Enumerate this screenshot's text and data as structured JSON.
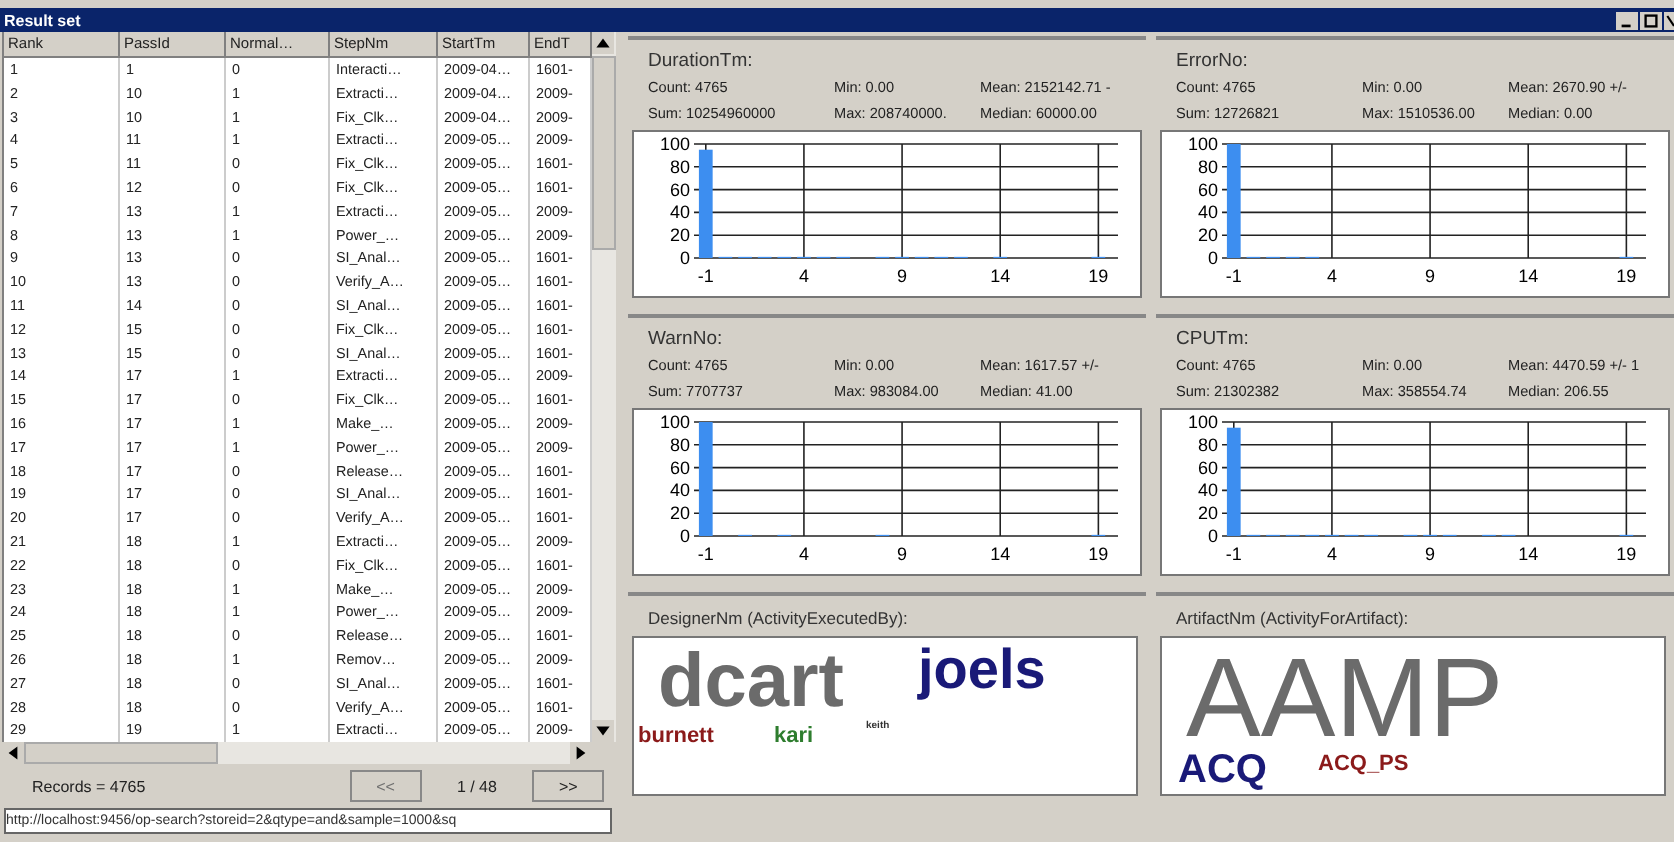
{
  "left_window": {
    "title": "Result set",
    "table": {
      "columns": [
        "Rank",
        "PassId",
        "Normal…",
        "StepNm",
        "StartTm",
        "EndT"
      ],
      "rows": [
        [
          "1",
          "1",
          "0",
          "Interacti…",
          "2009-04…",
          "1601-"
        ],
        [
          "2",
          "10",
          "1",
          "Extracti…",
          "2009-04…",
          "2009-"
        ],
        [
          "3",
          "10",
          "1",
          "Fix_Clk…",
          "2009-04…",
          "2009-"
        ],
        [
          "4",
          "11",
          "1",
          "Extracti…",
          "2009-05…",
          "2009-"
        ],
        [
          "5",
          "11",
          "0",
          "Fix_Clk…",
          "2009-05…",
          "1601-"
        ],
        [
          "6",
          "12",
          "0",
          "Fix_Clk…",
          "2009-05…",
          "1601-"
        ],
        [
          "7",
          "13",
          "1",
          "Extracti…",
          "2009-05…",
          "2009-"
        ],
        [
          "8",
          "13",
          "1",
          "Power_…",
          "2009-05…",
          "2009-"
        ],
        [
          "9",
          "13",
          "0",
          "SI_Anal…",
          "2009-05…",
          "1601-"
        ],
        [
          "10",
          "13",
          "0",
          "Verify_A…",
          "2009-05…",
          "1601-"
        ],
        [
          "11",
          "14",
          "0",
          "SI_Anal…",
          "2009-05…",
          "1601-"
        ],
        [
          "12",
          "15",
          "0",
          "Fix_Clk…",
          "2009-05…",
          "1601-"
        ],
        [
          "13",
          "15",
          "0",
          "SI_Anal…",
          "2009-05…",
          "1601-"
        ],
        [
          "14",
          "17",
          "1",
          "Extracti…",
          "2009-05…",
          "2009-"
        ],
        [
          "15",
          "17",
          "0",
          "Fix_Clk…",
          "2009-05…",
          "1601-"
        ],
        [
          "16",
          "17",
          "1",
          "Make_…",
          "2009-05…",
          "2009-"
        ],
        [
          "17",
          "17",
          "1",
          "Power_…",
          "2009-05…",
          "2009-"
        ],
        [
          "18",
          "17",
          "0",
          "Release…",
          "2009-05…",
          "1601-"
        ],
        [
          "19",
          "17",
          "0",
          "SI_Anal…",
          "2009-05…",
          "1601-"
        ],
        [
          "20",
          "17",
          "0",
          "Verify_A…",
          "2009-05…",
          "1601-"
        ],
        [
          "21",
          "18",
          "1",
          "Extracti…",
          "2009-05…",
          "2009-"
        ],
        [
          "22",
          "18",
          "0",
          "Fix_Clk…",
          "2009-05…",
          "1601-"
        ],
        [
          "23",
          "18",
          "1",
          "Make_…",
          "2009-05…",
          "2009-"
        ],
        [
          "24",
          "18",
          "1",
          "Power_…",
          "2009-05…",
          "2009-"
        ],
        [
          "25",
          "18",
          "0",
          "Release…",
          "2009-05…",
          "1601-"
        ],
        [
          "26",
          "18",
          "1",
          "Remov…",
          "2009-05…",
          "2009-"
        ],
        [
          "27",
          "18",
          "0",
          "SI_Anal…",
          "2009-05…",
          "1601-"
        ],
        [
          "28",
          "18",
          "0",
          "Verify_A…",
          "2009-05…",
          "1601-"
        ],
        [
          "29",
          "19",
          "1",
          "Extracti…",
          "2009-05…",
          "2009-"
        ]
      ]
    },
    "records": "Records = 4765",
    "prev_button": {
      "label": "<<",
      "disabled": true
    },
    "page": "1 / 48",
    "next_button": {
      "label": ">>",
      "disabled": false
    },
    "url": "http://localhost:9456/op-search?storeid=2&qtype=and&sample=1000&sq"
  },
  "right_window": {
    "charts": [
      {
        "title": "DurationTm:",
        "stats": [
          [
            "Count: 4765",
            "Min: 0.00",
            "Mean: 2152142.71 -"
          ],
          [
            "Sum: 10254960000",
            "Max: 208740000.",
            "Median: 60000.00"
          ]
        ],
        "chart_data": {
          "type": "bar",
          "x": [
            -1,
            0,
            1,
            2,
            3,
            4,
            5,
            6,
            7,
            8,
            9,
            10,
            11,
            12,
            13,
            14,
            15,
            16,
            17,
            18,
            19
          ],
          "values": [
            95,
            1,
            1,
            1,
            1,
            1,
            1,
            1,
            0,
            1,
            1,
            1,
            1,
            1,
            0,
            1,
            0,
            0,
            0,
            0,
            1
          ],
          "grid": true,
          "xlim": [
            -1.6,
            20
          ],
          "ylim": [
            0,
            100
          ],
          "xticks": [
            -1,
            4,
            9,
            14,
            19
          ],
          "yticks": [
            0,
            20,
            40,
            60,
            80,
            100
          ]
        }
      },
      {
        "title": "ErrorNo:",
        "stats": [
          [
            "Count: 4765",
            "Min: 0.00",
            "Mean: 2670.90 +/-"
          ],
          [
            "Sum: 12726821",
            "Max: 1510536.00",
            "Median: 0.00"
          ]
        ],
        "chart_data": {
          "type": "bar",
          "x": [
            -1,
            0,
            1,
            2,
            3,
            4,
            5,
            6,
            7,
            8,
            9,
            10,
            11,
            12,
            13,
            14,
            15,
            16,
            17,
            18,
            19
          ],
          "values": [
            100,
            1,
            1,
            1,
            1,
            0,
            0,
            0,
            0,
            0,
            0,
            0,
            0,
            0,
            0,
            0,
            0,
            0,
            0,
            0,
            1
          ],
          "grid": true,
          "xlim": [
            -1.6,
            20
          ],
          "ylim": [
            0,
            100
          ],
          "xticks": [
            -1,
            4,
            9,
            14,
            19
          ],
          "yticks": [
            0,
            20,
            40,
            60,
            80,
            100
          ]
        }
      },
      {
        "title": "WarnNo:",
        "stats": [
          [
            "Count: 4765",
            "Min: 0.00",
            "Mean: 1617.57 +/-"
          ],
          [
            "Sum: 7707737",
            "Max: 983084.00",
            "Median: 41.00"
          ]
        ],
        "chart_data": {
          "type": "bar",
          "x": [
            -1,
            0,
            1,
            2,
            3,
            4,
            5,
            6,
            7,
            8,
            9,
            10,
            11,
            12,
            13,
            14,
            15,
            16,
            17,
            18,
            19
          ],
          "values": [
            100,
            0,
            1,
            0,
            1,
            0,
            0,
            0,
            0,
            1,
            0,
            0,
            0,
            0,
            0,
            0,
            0,
            0,
            0,
            0,
            1
          ],
          "grid": true,
          "xlim": [
            -1.6,
            20
          ],
          "ylim": [
            0,
            100
          ],
          "xticks": [
            -1,
            4,
            9,
            14,
            19
          ],
          "yticks": [
            0,
            20,
            40,
            60,
            80,
            100
          ]
        }
      },
      {
        "title": "CPUTm:",
        "stats": [
          [
            "Count: 4765",
            "Min: 0.00",
            "Mean: 4470.59 +/- 1"
          ],
          [
            "Sum: 21302382",
            "Max: 358554.74",
            "Median: 206.55"
          ]
        ],
        "chart_data": {
          "type": "bar",
          "x": [
            -1,
            0,
            1,
            2,
            3,
            4,
            5,
            6,
            7,
            8,
            9,
            10,
            11,
            12,
            13,
            14,
            15,
            16,
            17,
            18,
            19
          ],
          "values": [
            95,
            1,
            1,
            1,
            1,
            1,
            1,
            1,
            0,
            1,
            1,
            1,
            0,
            1,
            1,
            0,
            0,
            0,
            0,
            0,
            1
          ],
          "grid": true,
          "xlim": [
            -1.6,
            20
          ],
          "ylim": [
            0,
            100
          ],
          "xticks": [
            -1,
            4,
            9,
            14,
            19
          ],
          "yticks": [
            0,
            20,
            40,
            60,
            80,
            100
          ]
        }
      }
    ],
    "clouds": [
      {
        "title": "DesignerNm (ActivityExecutedBy):",
        "words": [
          {
            "word": "dcart",
            "kind": "huge",
            "color": "#6b6b6b"
          },
          {
            "word": "joels",
            "kind": "large",
            "color": "#1a1a78"
          },
          {
            "word": "burnett",
            "kind": "small",
            "color": "#8b1a1a"
          },
          {
            "word": "kari",
            "kind": "small",
            "color": "#2e7d2e"
          },
          {
            "word": "keith",
            "kind": "tiny",
            "color": "#333333"
          }
        ]
      },
      {
        "title": "ArtifactNm (ActivityForArtifact):",
        "words": [
          {
            "word": "AAMP",
            "kind": "giant",
            "color": "#6b6b6b"
          },
          {
            "word": "ACQ",
            "kind": "medium",
            "color": "#1a1a78"
          },
          {
            "word": "ACQ_PS",
            "kind": "small",
            "color": "#8b1a1a"
          }
        ]
      }
    ]
  }
}
